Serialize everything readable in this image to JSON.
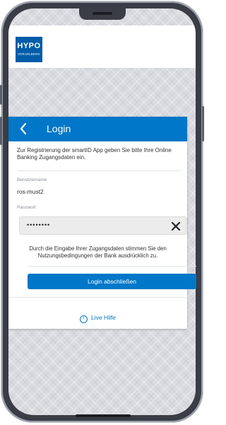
{
  "brand": {
    "name": "HYPO",
    "subtitle": "VORARLBERG",
    "color": "#005ca9"
  },
  "header": {
    "title": "Login",
    "back_icon": "chevron-left-icon"
  },
  "intro_text": "Zur Registrierung der smartID App geben Sie bitte Ihre Online Banking Zugangsdaten ein.",
  "username": {
    "label": "Benutzername",
    "value": "ros-must2"
  },
  "password": {
    "label": "Passwort",
    "value": "••••••••",
    "clear_icon": "close-icon"
  },
  "consent_text": "Durch die Eingabe Ihrer Zugangsdaten stimmen Sie den Nutzungsbedingungen der Bank ausdrücklich zu.",
  "submit_label": "Login abschließen",
  "help": {
    "icon_glyph": "!",
    "label": "Live Hilfe",
    "icon": "info-icon"
  },
  "colors": {
    "accent": "#0077c8",
    "header_bg": "#0077c8",
    "page_bg": "#d9dbe0"
  }
}
